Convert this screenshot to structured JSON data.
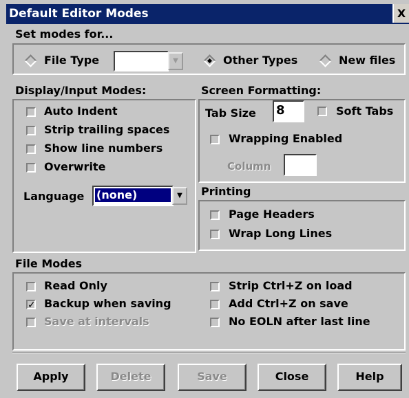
{
  "window": {
    "title": "Default Editor Modes",
    "close_glyph": "X"
  },
  "set_modes": {
    "label": "Set modes for...",
    "file_type_label": "File Type",
    "file_type_value": "",
    "other_types_label": "Other Types",
    "new_files_label": "New files",
    "selected": "Other Types"
  },
  "display_input": {
    "heading": "Display/Input Modes:",
    "items": [
      {
        "label": "Auto Indent",
        "checked": false
      },
      {
        "label": "Strip trailing spaces",
        "checked": false
      },
      {
        "label": "Show line numbers",
        "checked": false
      },
      {
        "label": "Overwrite",
        "checked": false
      }
    ],
    "language_label": "Language",
    "language_value": "(none)"
  },
  "screen_formatting": {
    "heading": "Screen Formatting:",
    "tab_size_label": "Tab Size",
    "tab_size_value": "8",
    "soft_tabs_label": "Soft Tabs",
    "wrapping_label": "Wrapping Enabled",
    "column_label": "Column",
    "column_value": ""
  },
  "printing": {
    "heading": "Printing",
    "items": [
      {
        "label": "Page Headers",
        "checked": false
      },
      {
        "label": "Wrap Long Lines",
        "checked": false
      }
    ]
  },
  "file_modes": {
    "heading": "File Modes",
    "left": [
      {
        "label": "Read Only",
        "checked": false
      },
      {
        "label": "Backup when saving",
        "checked": true,
        "mark": "✓"
      },
      {
        "label": "Save at intervals",
        "checked": false,
        "disabled": true
      }
    ],
    "right": [
      {
        "label": "Strip Ctrl+Z on load",
        "checked": false
      },
      {
        "label": "Add Ctrl+Z on save",
        "checked": false
      },
      {
        "label": "No EOLN after last line",
        "checked": false
      }
    ]
  },
  "buttons": {
    "apply": "Apply",
    "delete": "Delete",
    "save": "Save",
    "close": "Close",
    "help": "Help"
  },
  "colors": {
    "title_bar": "#0a246a",
    "face": "#c6c6c6",
    "selection": "#000080"
  }
}
